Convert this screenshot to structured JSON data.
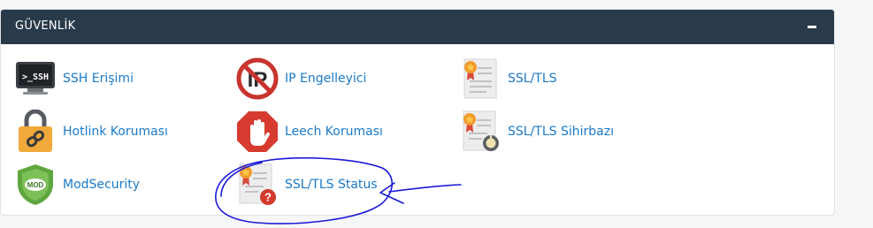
{
  "section": {
    "title": "GÜVENLİK",
    "collapse_symbol": "−"
  },
  "items": [
    {
      "label": "SSH Erişimi",
      "icon": "ssh-terminal-icon"
    },
    {
      "label": "IP Engelleyici",
      "icon": "ip-blocker-icon"
    },
    {
      "label": "SSL/TLS",
      "icon": "ssl-certificate-icon"
    },
    {
      "label": "Hotlink Koruması",
      "icon": "hotlink-padlock-icon"
    },
    {
      "label": "Leech Koruması",
      "icon": "leech-stop-hand-icon"
    },
    {
      "label": "SSL/TLS Sihirbazı",
      "icon": "ssl-wizard-icon"
    },
    {
      "label": "ModSecurity",
      "icon": "modsecurity-shield-icon"
    },
    {
      "label": "SSL/TLS Status",
      "icon": "ssl-status-icon"
    }
  ],
  "icon_text": {
    "ssh": ">_SSH",
    "ip": "IP",
    "mod": "MOD"
  },
  "colors": {
    "header_bg": "#293a4a",
    "link": "#1b7ac6",
    "annotation_ink": "#1a1ad6"
  }
}
